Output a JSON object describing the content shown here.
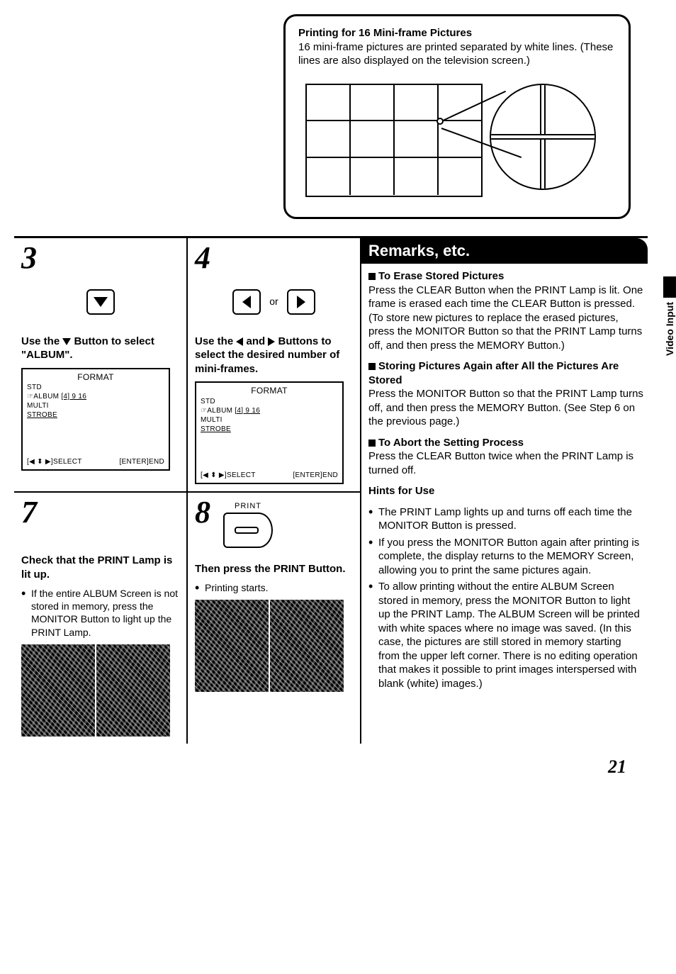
{
  "callout": {
    "title": "Printing for 16 Mini-frame Pictures",
    "body": "16 mini-frame pictures are printed separated by white lines. (These lines are also displayed on the television screen.)"
  },
  "steps": {
    "s3": {
      "num": "3",
      "text_a": "Use the ",
      "text_b": " Button to select \"ALBUM\"."
    },
    "s4": {
      "num": "4",
      "or": "or",
      "text_a": "Use the ",
      "text_b": " and ",
      "text_c": " Buttons to select the desired number of mini-frames."
    },
    "s7": {
      "num": "7",
      "text": "Check that the PRINT Lamp is lit up.",
      "sub": "If the entire ALBUM Screen is not stored in memory, press the MONITOR Button to light up the PRINT Lamp."
    },
    "s8": {
      "num": "8",
      "print_label": "PRINT",
      "text": "Then press the PRINT Button.",
      "sub": "Printing starts."
    }
  },
  "osd": {
    "title": "FORMAT",
    "l1": "STD",
    "l2_pre": "☞ALBUM",
    "l2_vals": "[4]   9   16",
    "l3": "MULTI",
    "l4": "STROBE",
    "foot_left": "[◀ ⬍ ▶]SELECT",
    "foot_right": "[ENTER]END"
  },
  "remarks": {
    "header": "Remarks, etc.",
    "r1_title": "To Erase Stored Pictures",
    "r1_body": "Press the CLEAR Button when the PRINT Lamp is lit. One frame is erased each time the CLEAR Button is pressed.\n(To store new pictures to replace the erased pictures, press the MONITOR Button so that the PRINT Lamp turns off, and then press the MEMORY Button.)",
    "r2_title": "Storing Pictures Again after All the Pictures Are Stored",
    "r2_body": "Press the MONITOR Button so that the PRINT Lamp turns off, and then press the MEMORY Button. (See Step 6 on the previous page.)",
    "r3_title": "To Abort the Setting Process",
    "r3_body": "Press the CLEAR Button twice when the PRINT Lamp is turned off.",
    "hints_title": "Hints for Use",
    "hints": [
      "The PRINT Lamp lights up and turns off each time the MONITOR Button is pressed.",
      "If you press the MONITOR Button again after printing is complete, the display returns to the MEMORY Screen, allowing you to print the same pictures again.",
      "To allow printing without the entire ALBUM Screen stored in memory, press the MONITOR Button to light up the PRINT Lamp. The ALBUM Screen will be printed with white spaces where no image was saved. (In this case, the pictures are still stored in memory starting from the upper left corner. There is no editing operation that makes it possible to print images interspersed with blank (white) images.)"
    ]
  },
  "side_tab": "Video Input",
  "page_num": "21"
}
